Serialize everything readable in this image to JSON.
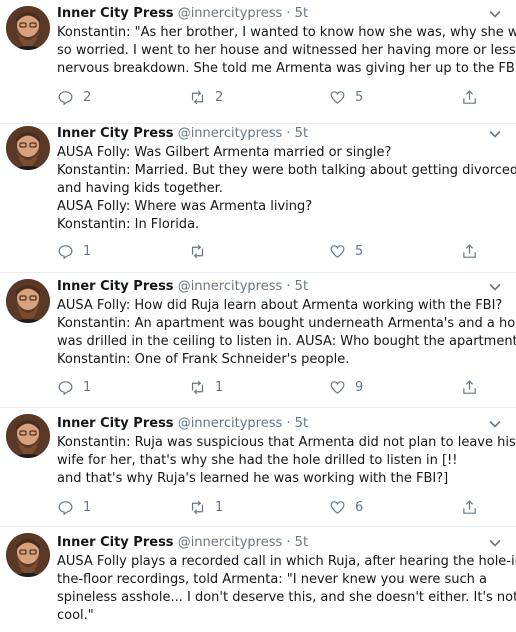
{
  "tweets": [
    {
      "name": "Inner City Press",
      "handle": "@innercitypress",
      "separator": "·",
      "time": "5t",
      "lines": [
        "Konstantin: \"As her brother, I wanted to know how she was, why she was",
        "so worried. I went to her house and witnessed her having more or less a",
        "nervous breakdown. She told me Armenta was giving her up to the FBI.\""
      ],
      "replies": "2",
      "retweets": "2",
      "likes": "5"
    },
    {
      "name": "Inner City Press",
      "handle": "@innercitypress",
      "separator": "·",
      "time": "5t",
      "lines": [
        "AUSA Folly: Was Gilbert Armenta married or single?",
        "Konstantin: Married. But they were both talking about getting divorced",
        "and having kids together.",
        "AUSA Folly: Where was Armenta living?",
        "Konstantin: In Florida."
      ],
      "replies": "1",
      "retweets": "",
      "likes": "5"
    },
    {
      "name": "Inner City Press",
      "handle": "@innercitypress",
      "separator": "·",
      "time": "5t",
      "lines": [
        "AUSA Folly: How did Ruja learn about Armenta working with the FBI?",
        "Konstantin: An apartment was bought underneath Armenta's and a hole",
        "was drilled in the ceiling to listen in. AUSA: Who bought the apartment?",
        "Konstantin: One of Frank Schneider's people."
      ],
      "replies": "1",
      "retweets": "1",
      "likes": "9"
    },
    {
      "name": "Inner City Press",
      "handle": "@innercitypress",
      "separator": "·",
      "time": "5t",
      "lines": [
        "Konstantin: Ruja was suspicious that Armenta did not plan to leave his",
        "wife for her, that's why she had the hole drilled to listen in [!!",
        "and that's why Ruja's learned he was working with the FBI?]"
      ],
      "replies": "1",
      "retweets": "1",
      "likes": "6"
    },
    {
      "name": "Inner City Press",
      "handle": "@innercitypress",
      "separator": "·",
      "time": "5t",
      "lines": [
        "AUSA Folly plays a recorded call in which Ruja, after hearing the hole-in-",
        "the-floor recordings, told Armenta: \"I never knew you were such a",
        "spineless asshole... I don't deserve this, and she doesn't either. It's not",
        "cool.\""
      ]
    }
  ],
  "icons": {
    "reply": "reply-icon",
    "retweet": "retweet-icon",
    "like": "heart-icon",
    "share": "share-icon",
    "caret": "chevron-down-icon"
  },
  "colors": {
    "text": "#14171a",
    "muted": "#657786",
    "divider": "#e6ecf0"
  }
}
